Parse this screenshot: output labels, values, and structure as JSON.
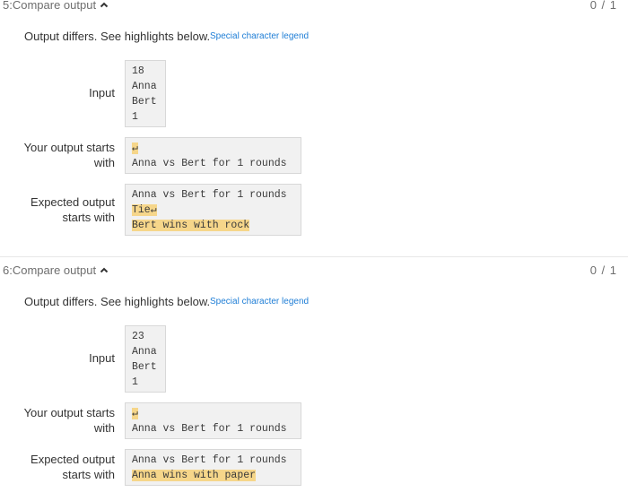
{
  "tests": [
    {
      "title": "5:Compare output",
      "score": "0 / 1",
      "differs": "Output differs. See highlights below.",
      "legend": "Special character legend",
      "input_label": "Input",
      "input_lines": [
        "18",
        "Anna",
        "Bert",
        "1"
      ],
      "your_label": [
        "Your output starts",
        "with"
      ],
      "your_lines": [
        {
          "text": "↵",
          "highlight": true
        },
        {
          "text": "Anna vs Bert for 1 rounds",
          "highlight": false
        }
      ],
      "expected_label": [
        "Expected output",
        "starts with"
      ],
      "expected_lines": [
        {
          "text": "Anna vs Bert for 1 rounds",
          "highlight": false
        },
        {
          "text": "Tie↵",
          "highlight": true
        },
        {
          "text": "Bert wins with rock",
          "highlight": true
        }
      ]
    },
    {
      "title": "6:Compare output",
      "score": "0 / 1",
      "differs": "Output differs. See highlights below.",
      "legend": "Special character legend",
      "input_label": "Input",
      "input_lines": [
        "23",
        "Anna",
        "Bert",
        "1"
      ],
      "your_label": [
        "Your output starts",
        "with"
      ],
      "your_lines": [
        {
          "text": "↵",
          "highlight": true
        },
        {
          "text": "Anna vs Bert for 1 rounds",
          "highlight": false
        }
      ],
      "expected_label": [
        "Expected output",
        "starts with"
      ],
      "expected_lines": [
        {
          "text": "Anna vs Bert for 1 rounds",
          "highlight": false
        },
        {
          "text": "Anna wins with paper",
          "highlight": true
        }
      ]
    }
  ],
  "colors": {
    "highlight": "#f6d68a",
    "link": "#1f7ed6",
    "box_background": "#f1f1f1"
  }
}
